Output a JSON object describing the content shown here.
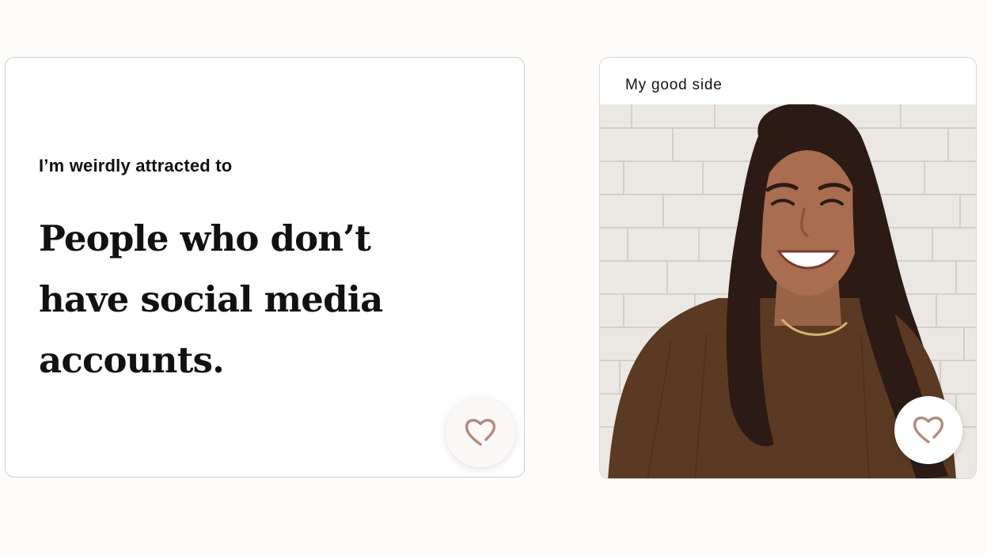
{
  "prompt_card": {
    "question": "I’m weirdly attracted to",
    "answer": "People who don’t have social media accounts.",
    "like_icon": "heart-outline-icon"
  },
  "photo_card": {
    "caption": "My good side",
    "like_icon": "heart-outline-icon"
  },
  "colors": {
    "heart_stroke": "#b48a7c",
    "sweater": "#5a3a22",
    "hair": "#2b1b14",
    "wall": "#ece9e4"
  }
}
